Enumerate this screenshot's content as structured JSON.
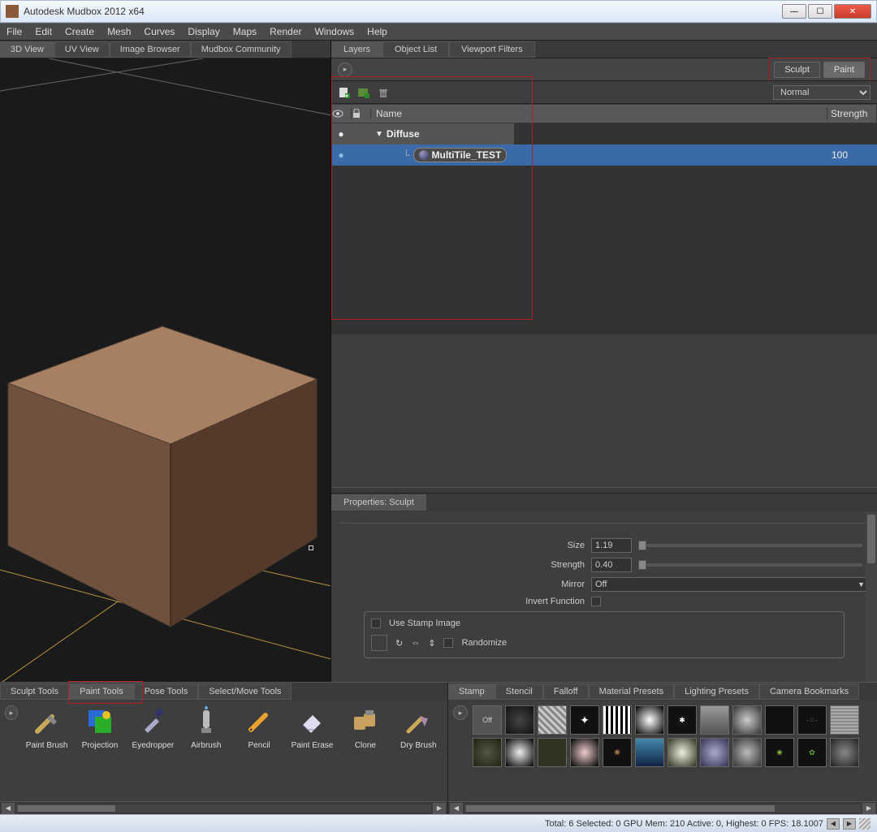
{
  "window": {
    "title": "Autodesk Mudbox 2012 x64"
  },
  "menu": [
    "File",
    "Edit",
    "Create",
    "Mesh",
    "Curves",
    "Display",
    "Maps",
    "Render",
    "Windows",
    "Help"
  ],
  "left_tabs": [
    "3D View",
    "UV View",
    "Image Browser",
    "Mudbox Community"
  ],
  "left_active": "3D View",
  "right_tabs": [
    "Layers",
    "Object List",
    "Viewport Filters"
  ],
  "right_active": "Layers",
  "mode_tabs": {
    "sculpt": "Sculpt",
    "paint": "Paint",
    "active": "Paint"
  },
  "blend_mode": "Normal",
  "layer_columns": {
    "name": "Name",
    "strength": "Strength"
  },
  "layer_group": {
    "label": "Diffuse"
  },
  "layer_item": {
    "name": "MultiTile_TEST",
    "strength": "100"
  },
  "properties": {
    "tab": "Properties: Sculpt",
    "size": {
      "label": "Size",
      "value": "1.19"
    },
    "strength": {
      "label": "Strength",
      "value": "0.40"
    },
    "mirror": {
      "label": "Mirror",
      "value": "Off"
    },
    "invert": {
      "label": "Invert Function"
    },
    "stamp": {
      "use": "Use Stamp Image",
      "randomize": "Randomize"
    }
  },
  "tool_tabs": [
    "Sculpt Tools",
    "Paint Tools",
    "Pose Tools",
    "Select/Move Tools"
  ],
  "tool_active": "Paint Tools",
  "brushes": [
    {
      "id": "paint-brush",
      "label": "Paint Brush"
    },
    {
      "id": "projection",
      "label": "Projection"
    },
    {
      "id": "eyedropper",
      "label": "Eyedropper"
    },
    {
      "id": "airbrush",
      "label": "Airbrush"
    },
    {
      "id": "pencil",
      "label": "Pencil"
    },
    {
      "id": "paint-erase",
      "label": "Paint Erase"
    },
    {
      "id": "clone",
      "label": "Clone"
    },
    {
      "id": "dry-brush",
      "label": "Dry Brush"
    }
  ],
  "stamp_tabs": [
    "Stamp",
    "Stencil",
    "Falloff",
    "Material Presets",
    "Lighting Presets",
    "Camera Bookmarks"
  ],
  "stamp_active": "Stamp",
  "stamp_off": "Off",
  "status": "Total: 6  Selected: 0 GPU Mem: 210  Active: 0, Highest: 0  FPS: 18.1007"
}
